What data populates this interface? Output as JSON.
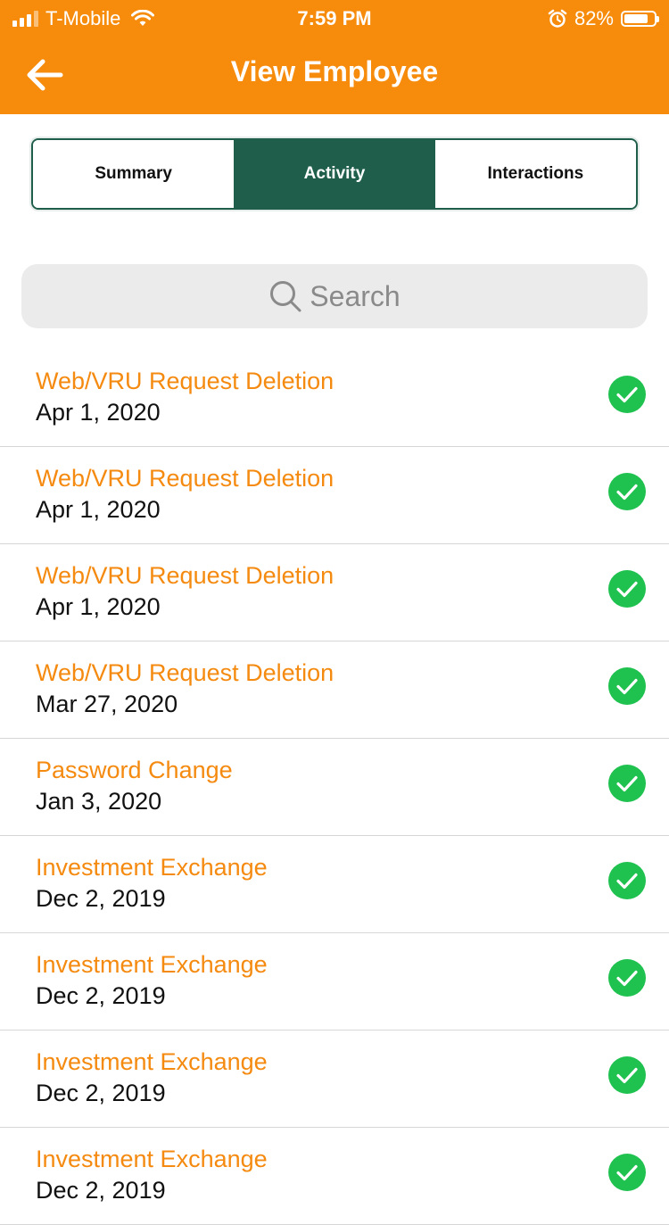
{
  "status_bar": {
    "carrier": "T-Mobile",
    "time": "7:59 PM",
    "battery_percent": "82%",
    "battery_level": 0.82,
    "signal_icon": "cellular-signal-icon",
    "wifi_icon": "wifi-icon",
    "alarm_icon": "alarm-clock-icon"
  },
  "header": {
    "title": "View Employee",
    "back_icon": "arrow-left-icon",
    "background_color": "#f68b0c"
  },
  "tabs": [
    {
      "label": "Summary",
      "active": false
    },
    {
      "label": "Activity",
      "active": true
    },
    {
      "label": "Interactions",
      "active": false
    }
  ],
  "search": {
    "placeholder": "Search",
    "icon": "search-icon"
  },
  "activity": [
    {
      "title": "Web/VRU Request Deletion",
      "date": "Apr 1, 2020",
      "status": "complete"
    },
    {
      "title": "Web/VRU Request Deletion",
      "date": "Apr 1, 2020",
      "status": "complete"
    },
    {
      "title": "Web/VRU Request Deletion",
      "date": "Apr 1, 2020",
      "status": "complete"
    },
    {
      "title": "Web/VRU Request Deletion",
      "date": "Mar 27, 2020",
      "status": "complete"
    },
    {
      "title": "Password Change",
      "date": "Jan 3, 2020",
      "status": "complete"
    },
    {
      "title": "Investment Exchange",
      "date": "Dec 2, 2019",
      "status": "complete"
    },
    {
      "title": "Investment Exchange",
      "date": "Dec 2, 2019",
      "status": "complete"
    },
    {
      "title": "Investment Exchange",
      "date": "Dec 2, 2019",
      "status": "complete"
    },
    {
      "title": "Investment Exchange",
      "date": "Dec 2, 2019",
      "status": "complete"
    }
  ],
  "colors": {
    "accent_orange": "#f68b0c",
    "tab_active_green": "#1e5e4b",
    "status_complete_green": "#1fc14f"
  }
}
